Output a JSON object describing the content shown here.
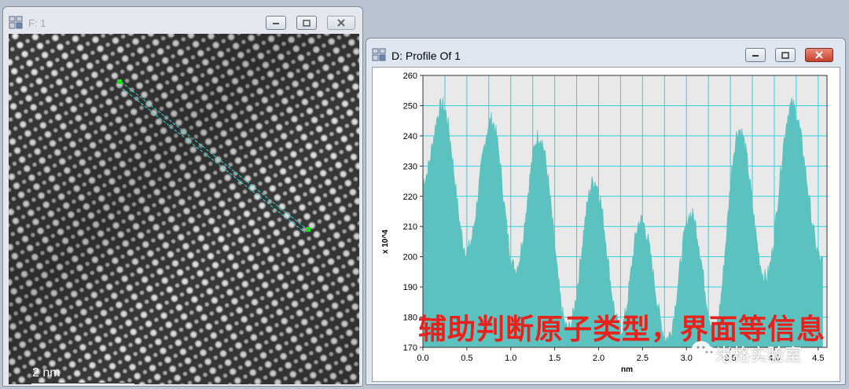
{
  "windows": {
    "image": {
      "title": "F: 1",
      "scale_label": "2 nm"
    },
    "profile": {
      "title": "D: Profile Of 1",
      "y_label": "x 10^4",
      "x_label": "nm"
    }
  },
  "chart_data": {
    "type": "area",
    "xlabel": "nm",
    "ylabel": "x 10^4",
    "xlim": [
      0.0,
      4.6
    ],
    "ylim": [
      170,
      260
    ],
    "x_ticks": [
      "0.0",
      "0.5",
      "1.0",
      "1.5",
      "2.0",
      "2.5",
      "3.0",
      "3.5",
      "4.0",
      "4.5"
    ],
    "y_ticks": [
      "170",
      "180",
      "190",
      "200",
      "210",
      "220",
      "230",
      "240",
      "250",
      "260"
    ],
    "grid": true,
    "color": "#5cc2c0",
    "peaks": [
      {
        "x": 0.22,
        "y": 250
      },
      {
        "x": 0.78,
        "y": 245
      },
      {
        "x": 1.32,
        "y": 240
      },
      {
        "x": 1.95,
        "y": 225
      },
      {
        "x": 2.48,
        "y": 212
      },
      {
        "x": 3.05,
        "y": 214
      },
      {
        "x": 3.6,
        "y": 242
      },
      {
        "x": 4.2,
        "y": 250
      }
    ],
    "valleys": [
      {
        "x": 0.0,
        "y": 225
      },
      {
        "x": 0.5,
        "y": 202
      },
      {
        "x": 1.05,
        "y": 196
      },
      {
        "x": 1.65,
        "y": 176
      },
      {
        "x": 2.25,
        "y": 176
      },
      {
        "x": 2.78,
        "y": 173
      },
      {
        "x": 3.32,
        "y": 176
      },
      {
        "x": 3.9,
        "y": 193
      },
      {
        "x": 4.55,
        "y": 198
      }
    ]
  },
  "overlay": {
    "caption": "辅助判断原子类型，界面等信息",
    "watermark": "米格实验室"
  },
  "icons": {
    "app": "app-window-icon",
    "minimize": "minimize-icon",
    "maximize": "maximize-icon",
    "close": "close-icon",
    "wechat": "wechat-icon"
  }
}
